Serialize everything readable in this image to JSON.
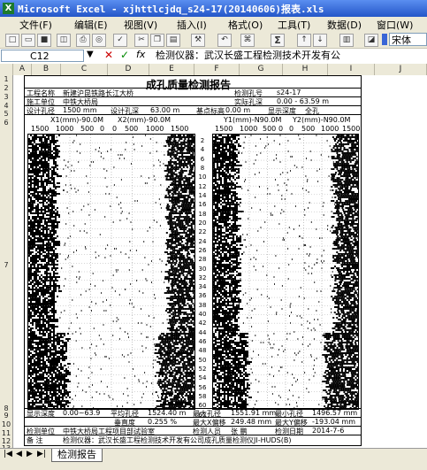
{
  "window": {
    "title": "Microsoft Excel - xjhttlcjdq_s24-17(20140606)报表.xls",
    "app_icon": "X"
  },
  "menu": [
    "文件(F)",
    "编辑(E)",
    "视图(V)",
    "插入(I)",
    "格式(O)",
    "工具(T)",
    "数据(D)",
    "窗口(W)"
  ],
  "toolbar": {
    "font": "宋体",
    "sigma": "Σ"
  },
  "formula": {
    "cell_ref": "C12",
    "content": "检测仪器：武汉长盛工程检测技术开发有公"
  },
  "columns": [
    "A",
    "B",
    "C",
    "D",
    "E",
    "F",
    "G",
    "H",
    "I",
    "J"
  ],
  "rows": [
    "1",
    "2",
    "3",
    "4",
    "5",
    "6",
    "7",
    "8",
    "9",
    "10",
    "11",
    "12",
    "13"
  ],
  "report": {
    "title": "成孔质量检测报告",
    "project_label": "工程名称",
    "project_value": "新建沪昆铁路长江大桥",
    "builder_label": "施工单位",
    "builder_value": "中铁大桥局",
    "design_dia_label": "设计孔径",
    "design_dia_value": "1500 mm",
    "design_depth_label": "设计孔深",
    "design_depth_value": "63.00 m",
    "base_label": "基点标高",
    "base_value": "0.00 m",
    "hole_no_label": "检测孔号",
    "hole_no_value": "s24-17",
    "measured_depth_label": "实际孔深",
    "measured_depth_value": "0.00 - 63.59 m",
    "display_label": "显示深度",
    "display_value": "全孔",
    "profiles": [
      {
        "label": "X1(mm)-90.0M",
        "axis": [
          "1500",
          "1000",
          "500",
          "0"
        ]
      },
      {
        "label": "X2(mm)-90.0M",
        "axis": [
          "0",
          "500",
          "1000",
          "1500"
        ]
      },
      {
        "label": "Y1(mm)-N90.0M",
        "axis": [
          "1500",
          "1000",
          "500",
          "0"
        ]
      },
      {
        "label": "Y2(mm)-N90.0M",
        "axis": [
          "0",
          "500",
          "1000",
          "1500"
        ]
      }
    ],
    "depth_marks": [
      "2",
      "4",
      "6",
      "8",
      "10",
      "12",
      "14",
      "16",
      "18",
      "20",
      "22",
      "24",
      "26",
      "28",
      "30",
      "32",
      "34",
      "36",
      "38",
      "40",
      "42",
      "44",
      "46",
      "48",
      "50",
      "52",
      "54",
      "56",
      "58",
      "60",
      "62"
    ],
    "footer": {
      "r9": [
        "显示深度",
        "0.00~63.9",
        "平均孔径",
        "1524.40 m",
        "最大孔径",
        "1551.91 mm",
        "最小孔径",
        "1496.57 mm"
      ],
      "r10": [
        "",
        "",
        "垂直度",
        "0.255 %",
        "最大X偏移",
        "249.48 mm",
        "最大Y偏移",
        "-193.04 mm"
      ],
      "r11": [
        "检测单位",
        "中铁大桥局工程项目部试验室",
        "",
        "",
        "检测人员",
        "张 鹏",
        "检测日期",
        "2014-7-6"
      ],
      "r12": [
        "备  注",
        "检测仪器：武汉长盛工程检测技术开发有公司成孔质量检测仪JI-HUDS(B)"
      ]
    }
  },
  "sheet_tab": "检测报告"
}
